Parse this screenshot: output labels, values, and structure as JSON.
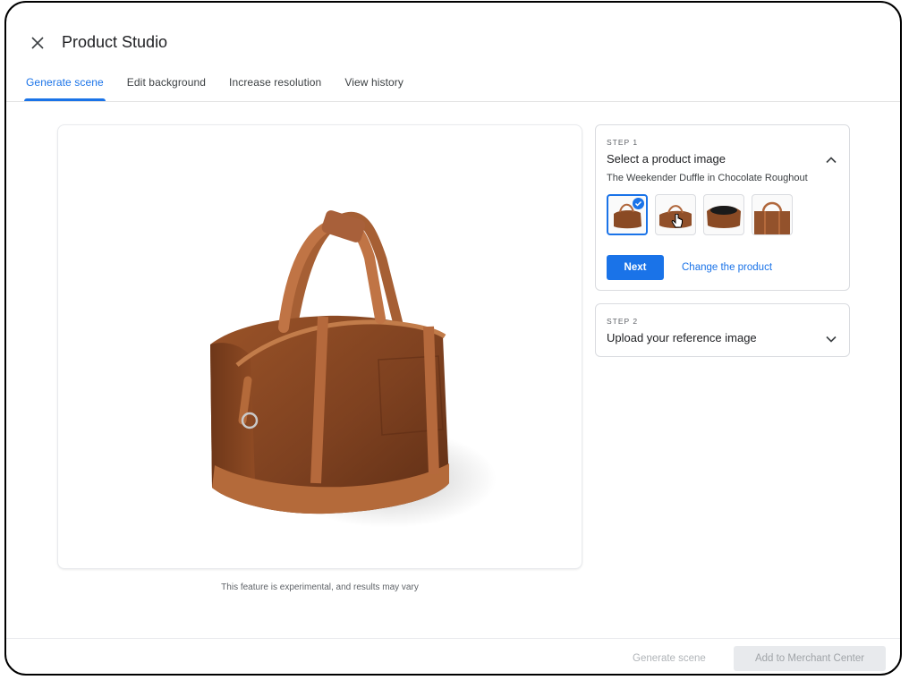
{
  "app": {
    "title": "Product Studio"
  },
  "colors": {
    "accent": "#1a73e8",
    "leather": "#8a4a24",
    "strap": "#b0673c"
  },
  "tabs": [
    {
      "label": "Generate scene",
      "active": true
    },
    {
      "label": "Edit background",
      "active": false
    },
    {
      "label": "Increase resolution",
      "active": false
    },
    {
      "label": "View history",
      "active": false
    }
  ],
  "preview": {
    "disclaimer": "This feature is experimental, and results may vary"
  },
  "step1": {
    "label": "STEP 1",
    "title": "Select a product image",
    "product_name": "The Weekender Duffle in Chocolate Roughout",
    "next_label": "Next",
    "change_label": "Change the product",
    "expanded": true,
    "thumbnails": [
      {
        "name": "front",
        "selected": true
      },
      {
        "name": "front-side",
        "selected": false
      },
      {
        "name": "open-top",
        "selected": false
      },
      {
        "name": "detail",
        "selected": false
      }
    ]
  },
  "step2": {
    "label": "STEP 2",
    "title": "Upload your reference image",
    "expanded": false
  },
  "footer": {
    "generate_label": "Generate scene",
    "add_label": "Add to Merchant Center"
  }
}
